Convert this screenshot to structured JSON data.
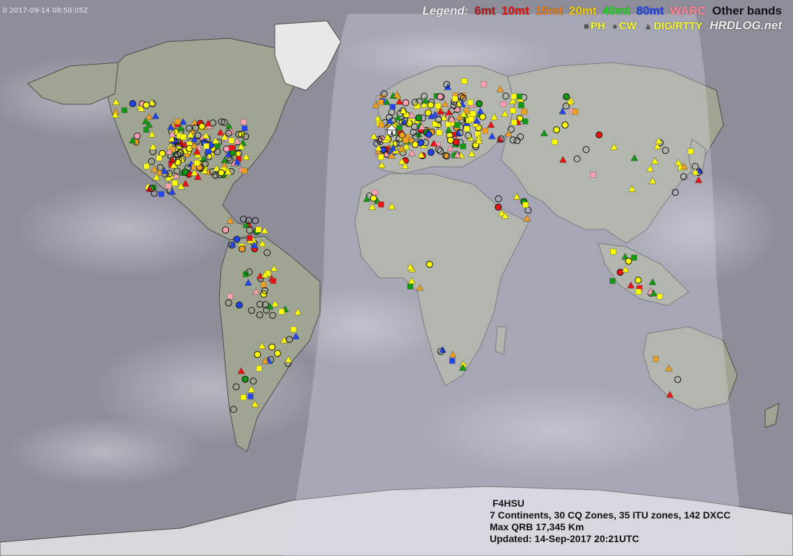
{
  "map": {
    "timestamp": "0 2017-09-14 08:50:05Z",
    "legend": {
      "title": "Legend:",
      "bands": [
        {
          "label": "6mt",
          "color": "#b22222"
        },
        {
          "label": "10mt",
          "color": "#ee1111"
        },
        {
          "label": "15mt",
          "color": "#f0801a"
        },
        {
          "label": "20mt",
          "color": "#f8d010"
        },
        {
          "label": "40mt",
          "color": "#22dd22"
        },
        {
          "label": "80mt",
          "color": "#2244ee"
        },
        {
          "label": "WARC",
          "color": "#ff8899"
        },
        {
          "label": "Other bands",
          "color": "#111111"
        }
      ],
      "modes": [
        {
          "symbol": "square",
          "label": "PH"
        },
        {
          "symbol": "circle",
          "label": "CW"
        },
        {
          "symbol": "triangle",
          "label": "DIG/RTTY"
        }
      ],
      "brand": "HRDLOG.net"
    },
    "stats": {
      "callsign": "F4HSU",
      "coverage": "7 Continents, 30 CQ Zones, 35 ITU zones, 142 DXCC",
      "max_qrb": "Max QRB 17,345 Km",
      "updated": "Updated: 14-Sep-2017 20:21UTC"
    }
  }
}
